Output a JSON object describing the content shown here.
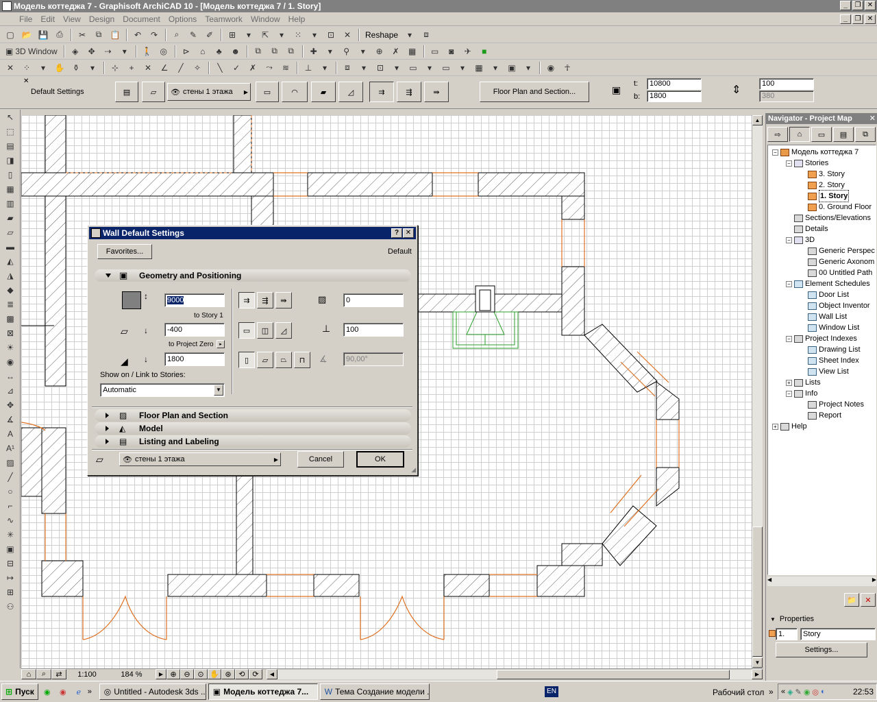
{
  "window": {
    "title": "Модель коттеджа 7 - Graphisoft ArchiCAD 10 - [Модель коттеджа 7 / 1. Story]",
    "min": "_",
    "restore": "❐",
    "close": "✕"
  },
  "menu": [
    "File",
    "Edit",
    "View",
    "Design",
    "Document",
    "Options",
    "Teamwork",
    "Window",
    "Help"
  ],
  "toolbar": {
    "reshape": "Reshape",
    "window3d": "3D Window"
  },
  "infobox": {
    "settings_label": "Default Settings",
    "layer": "стены 1 этажа",
    "floor_plan_btn": "Floor Plan and Section...",
    "t_label": "t:",
    "t_value": "10800",
    "b_label": "b:",
    "b_value": "1800",
    "height_value": "100",
    "height2_value": "380"
  },
  "navigator": {
    "title": "Navigator - Project Map",
    "tree": [
      {
        "label": "Модель коттеджа 7",
        "level": 0,
        "box": "−",
        "icon": "house"
      },
      {
        "label": "Stories",
        "level": 1,
        "box": "−",
        "icon": "stor"
      },
      {
        "label": "3. Story",
        "level": 2,
        "icon": "story"
      },
      {
        "label": "2. Story",
        "level": 2,
        "icon": "story"
      },
      {
        "label": "1. Story",
        "level": 2,
        "icon": "story",
        "selected": true
      },
      {
        "label": "0. Ground Floor",
        "level": 2,
        "icon": "story"
      },
      {
        "label": "Sections/Elevations",
        "level": 1,
        "icon": "pl"
      },
      {
        "label": "Details",
        "level": 1,
        "icon": "pl"
      },
      {
        "label": "3D",
        "level": 1,
        "box": "−",
        "icon": "stor"
      },
      {
        "label": "Generic Perspec",
        "level": 2,
        "icon": "pl"
      },
      {
        "label": "Generic Axonom",
        "level": 2,
        "icon": "pl"
      },
      {
        "label": "00 Untitled Path",
        "level": 2,
        "icon": "pl"
      },
      {
        "label": "Element Schedules",
        "level": 1,
        "box": "−",
        "icon": "sch"
      },
      {
        "label": "Door List",
        "level": 2,
        "icon": "sch"
      },
      {
        "label": "Object Inventor",
        "level": 2,
        "icon": "sch"
      },
      {
        "label": "Wall List",
        "level": 2,
        "icon": "sch"
      },
      {
        "label": "Window List",
        "level": 2,
        "icon": "sch"
      },
      {
        "label": "Project Indexes",
        "level": 1,
        "box": "−",
        "icon": "pl"
      },
      {
        "label": "Drawing List",
        "level": 2,
        "icon": "sch"
      },
      {
        "label": "Sheet Index",
        "level": 2,
        "icon": "sch"
      },
      {
        "label": "View List",
        "level": 2,
        "icon": "sch"
      },
      {
        "label": "Lists",
        "level": 1,
        "box": "+",
        "icon": "pl"
      },
      {
        "label": "Info",
        "level": 1,
        "box": "−",
        "icon": "pl"
      },
      {
        "label": "Project Notes",
        "level": 2,
        "icon": "pl"
      },
      {
        "label": "Report",
        "level": 2,
        "icon": "pl"
      },
      {
        "label": "Help",
        "level": 0,
        "box": "+",
        "icon": "pl"
      }
    ],
    "properties_label": "Properties",
    "prop_num": "1.",
    "prop_name": "Story",
    "settings_btn": "Settings..."
  },
  "dialog": {
    "title": "Wall Default Settings",
    "help": "?",
    "close": "✕",
    "favorites": "Favorites...",
    "default_label": "Default",
    "geometry_panel": "Geometry and Positioning",
    "height_value": "9000",
    "to_story": "to Story 1",
    "base_offset_value": "-400",
    "to_project_zero": "to Project Zero",
    "thickness_value": "1800",
    "show_on_label": "Show on / Link to Stories:",
    "show_on_value": "Automatic",
    "offset_value": "0",
    "ref_value": "100",
    "angle_value": "90,00°",
    "floor_plan_panel": "Floor Plan and Section",
    "model_panel": "Model",
    "listing_panel": "Listing and Labeling",
    "layer": "стены 1 этажа",
    "cancel": "Cancel",
    "ok": "OK"
  },
  "status": {
    "scale": "1:100",
    "zoom": "184 %"
  },
  "taskbar": {
    "start": "Пуск",
    "tasks": [
      "Untitled - Autodesk 3ds ...",
      "Модель коттеджа 7...",
      "Тема Создание модели ..."
    ],
    "lang": "EN",
    "desktop": "Рабочий стол",
    "time": "22:53"
  }
}
